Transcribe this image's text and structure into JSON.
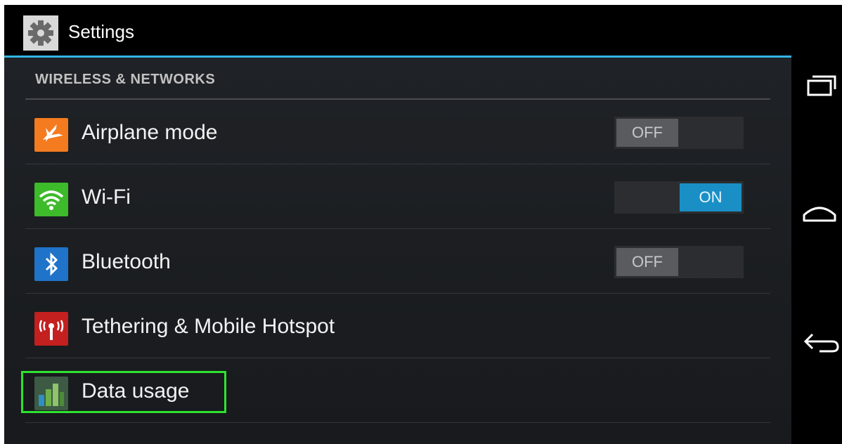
{
  "action_bar": {
    "title": "Settings",
    "icon": "gear-icon"
  },
  "section": {
    "header": "WIRELESS & NETWORKS"
  },
  "items": [
    {
      "label": "Airplane mode",
      "icon": "airplane-icon",
      "icon_color": "#f47b20",
      "toggle": "OFF"
    },
    {
      "label": "Wi-Fi",
      "icon": "wifi-icon",
      "icon_color": "#3dbb2a",
      "toggle": "ON"
    },
    {
      "label": "Bluetooth",
      "icon": "bluetooth-icon",
      "icon_color": "#1f73c9",
      "toggle": "OFF"
    },
    {
      "label": "Tethering & Mobile Hotspot",
      "icon": "hotspot-icon",
      "icon_color": "#c3201f"
    },
    {
      "label": "Data usage",
      "icon": "data-usage-icon",
      "icon_color": "#4a7a3a",
      "highlighted": true
    }
  ],
  "nav": {
    "recent": "recent-apps-icon",
    "home": "home-icon",
    "back": "back-icon"
  },
  "colors": {
    "accent": "#33b5e5",
    "toggle_on": "#1a8fc6",
    "highlight": "#2ee32e"
  }
}
